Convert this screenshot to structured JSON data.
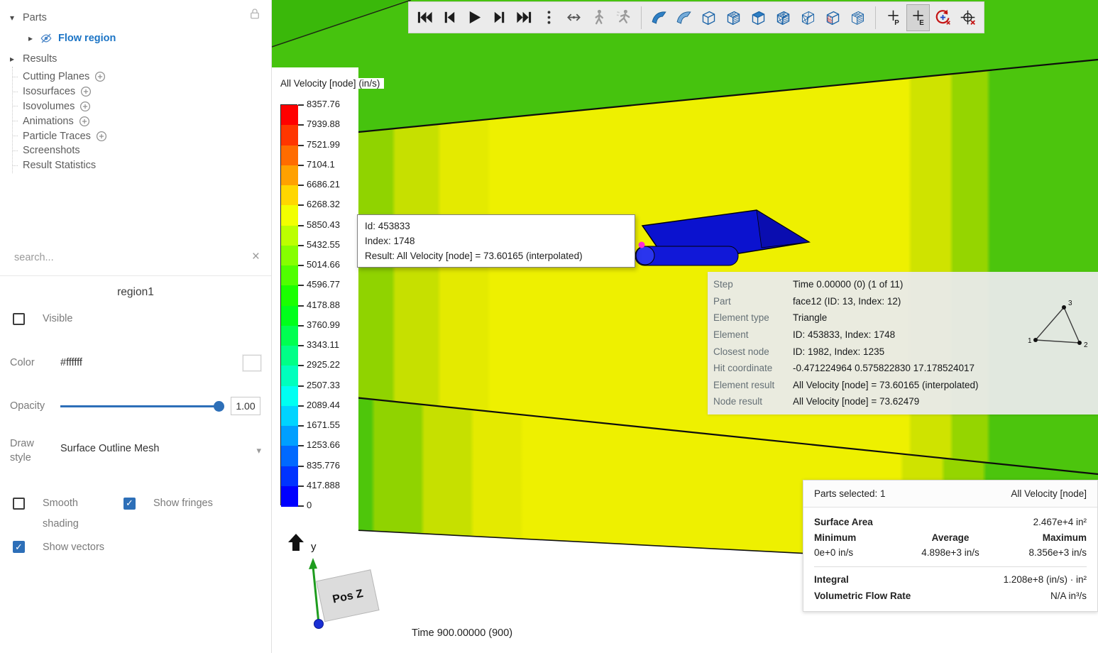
{
  "sidebar": {
    "parts_label": "Parts",
    "flow_region_label": "Flow region",
    "results_label": "Results",
    "result_items": [
      {
        "label": "Cutting Planes",
        "add": true
      },
      {
        "label": "Isosurfaces",
        "add": true
      },
      {
        "label": "Isovolumes",
        "add": true
      },
      {
        "label": "Animations",
        "add": true
      },
      {
        "label": "Particle Traces",
        "add": true
      },
      {
        "label": "Screenshots",
        "add": false
      },
      {
        "label": "Result Statistics",
        "add": false
      }
    ],
    "search_placeholder": "search...",
    "properties": {
      "title": "region1",
      "visible": {
        "label": "Visible",
        "checked": false
      },
      "color": {
        "label": "Color",
        "value": "#ffffff"
      },
      "opacity": {
        "label": "Opacity",
        "value": "1.00",
        "percent": 100
      },
      "draw_style": {
        "label_line1": "Draw",
        "label_line2": "style",
        "value": "Surface Outline Mesh"
      },
      "smooth_shading": {
        "label_line1": "Smooth",
        "label_line2": "shading",
        "checked": false
      },
      "show_fringes": {
        "label": "Show fringes",
        "checked": true
      },
      "show_vectors": {
        "label": "Show vectors",
        "checked": true
      }
    },
    "icons": {
      "lock": "lock-icon",
      "flow_visibility": "eye-off-icon",
      "add": "circle-plus-icon",
      "clear_search": "close-icon"
    }
  },
  "toolbar": {
    "groups": [
      {
        "name": "playback",
        "icons": [
          "skip-start",
          "step-back",
          "play",
          "step-forward",
          "skip-end"
        ]
      },
      {
        "name": "overflow",
        "icons": [
          "kebab"
        ]
      },
      {
        "name": "trace",
        "icons": [
          "span-horizontal",
          "person-walk",
          "person-run"
        ]
      },
      {
        "name": "views",
        "icons": [
          "view-flag-solid",
          "view-flag-light",
          "view-box-open",
          "view-box-grid",
          "view-box-solid",
          "view-box-mesh",
          "view-box-wire",
          "view-box-red-mesh",
          "view-box-cage"
        ]
      },
      {
        "name": "probe",
        "icons": [
          "pick-point-p",
          "pick-element-e",
          "rotate-probe",
          "pick-clear"
        ]
      }
    ],
    "active_icon": "pick-element-e",
    "separators_after": [
      "trace",
      "views"
    ]
  },
  "viewport": {
    "legend": {
      "title": "All Velocity [node] (in/s)",
      "tick_labels": [
        "8357.76",
        "7939.88",
        "7521.99",
        "7104.1",
        "6686.21",
        "6268.32",
        "5850.43",
        "5432.55",
        "5014.66",
        "4596.77",
        "4178.88",
        "3760.99",
        "3343.11",
        "2925.22",
        "2507.33",
        "2089.44",
        "1671.55",
        "1253.66",
        "835.776",
        "417.888",
        "0"
      ],
      "colors": [
        "#ff0000",
        "#ff3600",
        "#ff6c00",
        "#ffa100",
        "#ffd700",
        "#f2ff00",
        "#bcff00",
        "#86ff00",
        "#50ff00",
        "#1aff00",
        "#00ff1b",
        "#00ff51",
        "#00ff87",
        "#00ffbd",
        "#00fff2",
        "#00d4ff",
        "#009fff",
        "#0069ff",
        "#0033ff",
        "#0000ff"
      ]
    },
    "tooltip": {
      "lines": [
        "Id: 453833",
        "Index: 1748",
        "Result: All Velocity [node] = 73.60165 (interpolated)"
      ]
    },
    "probe_panel": {
      "rows": [
        {
          "label": "Step",
          "value": "Time 0.00000 (0) (1 of 11)"
        },
        {
          "label": "Part",
          "value": "face12 (ID: 13, Index: 12)"
        },
        {
          "label": "Element type",
          "value": "Triangle"
        },
        {
          "label": "Element",
          "value": "ID: 453833, Index: 1748"
        },
        {
          "label": "Closest node",
          "value": "ID: 1982, Index: 1235"
        },
        {
          "label": "Hit coordinate",
          "value": "-0.471224964 0.575822830 17.178524017"
        },
        {
          "label": "Element result",
          "value": "All Velocity [node] = 73.60165 (interpolated)"
        },
        {
          "label": "Node result",
          "value": "All Velocity [node] = 73.62479"
        }
      ],
      "triangle_labels": {
        "n1": "1",
        "n2": "2",
        "n3": "3"
      }
    },
    "stats_panel": {
      "parts_selected": "Parts selected: 1",
      "result_name": "All Velocity [node]",
      "surface_area_label": "Surface Area",
      "surface_area_value": "2.467e+4 in²",
      "min_label": "Minimum",
      "avg_label": "Average",
      "max_label": "Maximum",
      "min_value": "0e+0 in/s",
      "avg_value": "4.898e+3 in/s",
      "max_value": "8.356e+3 in/s",
      "integral_label": "Integral",
      "integral_value": "1.208e+8 (in/s) · in²",
      "flow_label": "Volumetric Flow Rate",
      "flow_value": "N/A in³/s"
    },
    "time_label": "Time 900.00000 (900)",
    "triad": {
      "y_axis_label": "y",
      "cube_label": "Pos Z"
    },
    "colors": {
      "contour_green": "#4cc50d",
      "contour_yellow": "#eef000",
      "probe_blue": "#0b12cf",
      "probe_marker_magenta": "#ff2ad4"
    }
  }
}
